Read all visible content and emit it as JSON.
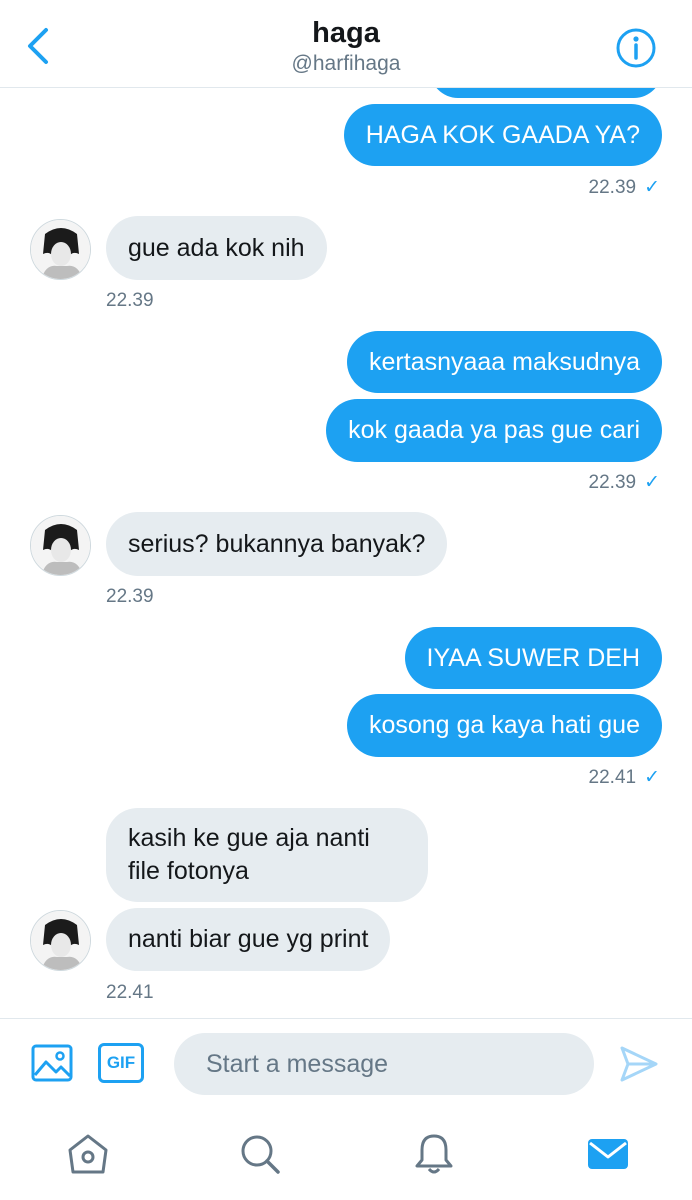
{
  "header": {
    "title": "haga",
    "handle": "@harfihaga"
  },
  "messages": [
    {
      "direction": "out",
      "text": "HAGA KOK GAADA YA?"
    },
    {
      "direction": "out",
      "time": "22.39",
      "status": "✓"
    },
    {
      "direction": "in",
      "text": "gue ada kok nih"
    },
    {
      "direction": "in",
      "time": "22.39"
    },
    {
      "direction": "out",
      "text": "kertasnyaaa maksudnya"
    },
    {
      "direction": "out",
      "text": "kok gaada ya pas gue cari"
    },
    {
      "direction": "out",
      "time": "22.39",
      "status": "✓"
    },
    {
      "direction": "in",
      "text": "serius? bukannya banyak?"
    },
    {
      "direction": "in",
      "time": "22.39"
    },
    {
      "direction": "out",
      "text": "IYAA SUWER DEH"
    },
    {
      "direction": "out",
      "text": "kosong ga kaya hati gue"
    },
    {
      "direction": "out",
      "time": "22.41",
      "status": "✓"
    },
    {
      "direction": "in",
      "text": "kasih ke gue aja nanti file fotonya"
    },
    {
      "direction": "in",
      "text": "nanti biar gue yg print"
    },
    {
      "direction": "in",
      "time": "22.41"
    }
  ],
  "composer": {
    "gif_label": "GIF",
    "placeholder": "Start a message"
  },
  "icons": {
    "back": "chevron-left-icon",
    "info": "info-icon",
    "media": "image-icon",
    "send": "send-icon",
    "tabs": [
      "home-icon",
      "search-icon",
      "notifications-icon",
      "messages-icon"
    ]
  },
  "colors": {
    "accent": "#1da1f2",
    "incoming_bubble": "#e6ecf0",
    "secondary_text": "#657786"
  }
}
